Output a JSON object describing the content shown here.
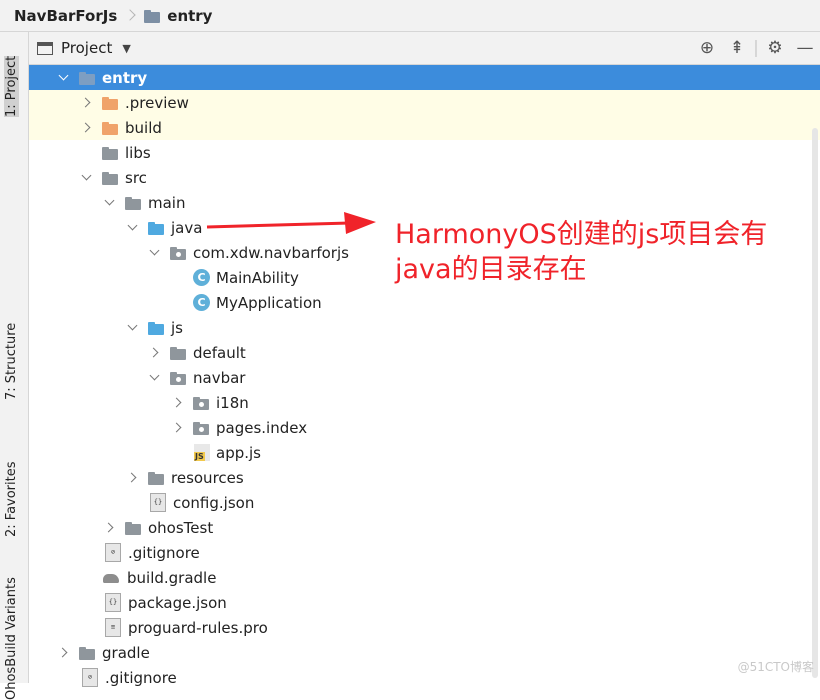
{
  "breadcrumb": {
    "root": "NavBarForJs",
    "current": "entry"
  },
  "sidebar_tabs": {
    "project": "1: Project",
    "structure": "7: Structure",
    "favorites": "2: Favorites",
    "variants": "OhosBuild Variants"
  },
  "panel": {
    "title": "Project"
  },
  "tree": {
    "entry": "entry",
    "preview": ".preview",
    "build": "build",
    "libs": "libs",
    "src": "src",
    "main": "main",
    "java": "java",
    "pkg": "com.xdw.navbarforjs",
    "mainability": "MainAbility",
    "myapplication": "MyApplication",
    "js": "js",
    "default": "default",
    "navbar": "navbar",
    "i18n": "i18n",
    "pages": "pages.index",
    "appjs": "app.js",
    "resources": "resources",
    "config": "config.json",
    "ohostest": "ohosTest",
    "gitignore": ".gitignore",
    "buildgradle": "build.gradle",
    "packagejson": "package.json",
    "proguard": "proguard-rules.pro",
    "gradle": "gradle",
    "gitignore2": ".gitignore"
  },
  "annotation": {
    "line1": "HarmonyOS创建的js项目会有",
    "line2": "java的目录存在"
  },
  "watermark": "@51CTO博客",
  "colors": {
    "selection": "#3c8cdc",
    "annotation": "#f0232a",
    "highlight_row": "#fffde6"
  }
}
